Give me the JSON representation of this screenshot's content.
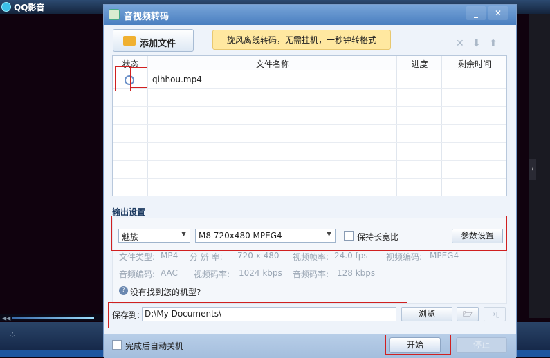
{
  "player": {
    "title": "QQ影音"
  },
  "dialog": {
    "title": "音视频转码",
    "add_file_label": "添加文件",
    "promo_text": "旋风离线转码，无需挂机，一秒钟转格式",
    "table": {
      "columns": [
        "状态",
        "文件名称",
        "进度",
        "剩余时间"
      ],
      "rows": [
        {
          "status": "",
          "name": "qihhou.mp4",
          "progress": "",
          "remaining": ""
        }
      ]
    },
    "output": {
      "label": "输出设置",
      "brand": "魅族",
      "model": "M8 720x480 MPEG4",
      "keep_ratio_label": "保持长宽比",
      "params_button": "参数设置",
      "info": {
        "file_type_label": "文件类型:",
        "file_type": "MP4",
        "resolution_label": "分 辨 率:",
        "resolution": "720 x 480",
        "fps_label": "视频帧率:",
        "fps": "24.0 fps",
        "vcodec_label": "视频编码:",
        "vcodec": "MPEG4",
        "acodec_label": "音频编码:",
        "acodec": "AAC",
        "vbitrate_label": "视频码率:",
        "vbitrate": "1024 kbps",
        "abitrate_label": "音频码率:",
        "abitrate": "128 kbps"
      },
      "help_text": "没有找到您的机型?"
    },
    "save": {
      "label": "保存到:",
      "path": "D:\\My Documents\\",
      "browse": "浏览"
    },
    "footer": {
      "shutdown_label": "完成后自动关机",
      "start": "开始",
      "stop": "停止"
    }
  }
}
